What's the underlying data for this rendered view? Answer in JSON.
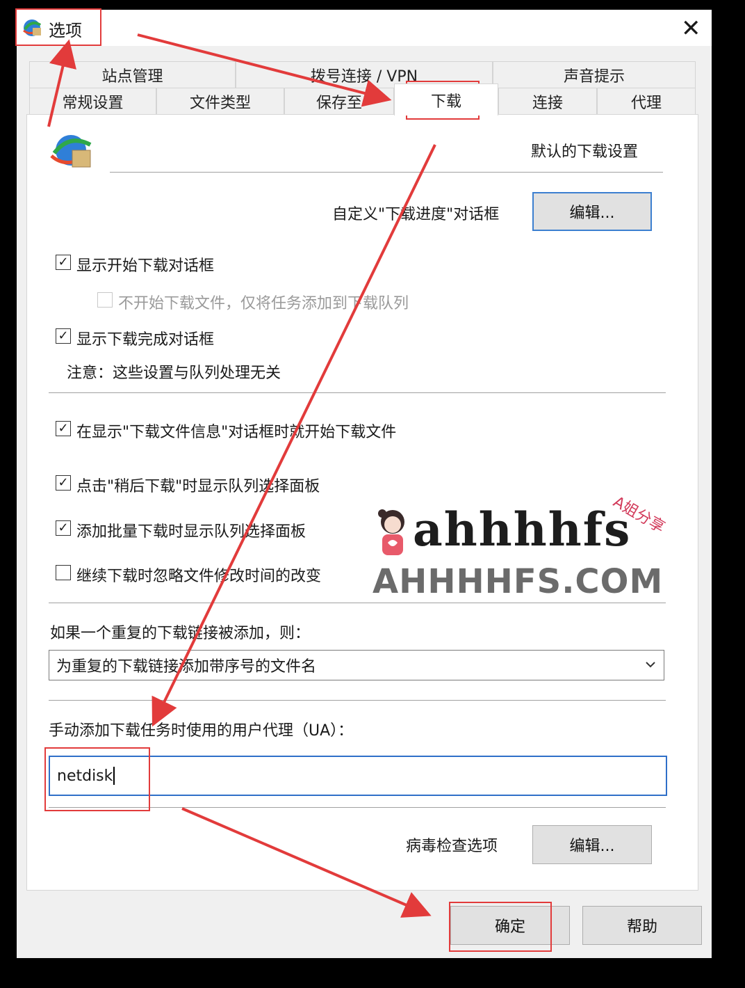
{
  "window": {
    "title": "选项",
    "close_glyph": "✕"
  },
  "tabs_row1": [
    "站点管理",
    "拨号连接 / VPN",
    "声音提示"
  ],
  "tabs_row2": [
    "常规设置",
    "文件类型",
    "保存至",
    "下载",
    "连接",
    "代理"
  ],
  "active_tab": "下载",
  "section_title": "默认的下载设置",
  "progress_dialog": {
    "label": "自定义\"下载进度\"对话框",
    "button": "编辑..."
  },
  "options": {
    "show_start_dialog": {
      "label": "显示开始下载对话框",
      "checked": true
    },
    "queue_without_start": {
      "label": "不开始下载文件，仅将任务添加到下载队列",
      "checked": false,
      "disabled": true
    },
    "show_complete_dialog": {
      "label": "显示下载完成对话框",
      "checked": true
    },
    "note": "注意：这些设置与队列处理无关",
    "start_on_info_dialog": {
      "label": "在显示\"下载文件信息\"对话框时就开始下载文件",
      "checked": true
    },
    "queue_panel_later": {
      "label": "点击\"稍后下载\"时显示队列选择面板",
      "checked": true
    },
    "queue_panel_batch": {
      "label": "添加批量下载时显示队列选择面板",
      "checked": true
    },
    "ignore_modified_time": {
      "label": "继续下载时忽略文件修改时间的改变",
      "checked": false
    }
  },
  "duplicate": {
    "label": "如果一个重复的下载链接被添加，则：",
    "selected": "为重复的下载链接添加带序号的文件名"
  },
  "user_agent": {
    "label": "手动添加下载任务时使用的用户代理（UA）：",
    "value": "netdisk"
  },
  "virus_check": {
    "label": "病毒检查选项",
    "button": "编辑..."
  },
  "footer": {
    "ok": "确定",
    "help": "帮助"
  },
  "watermark": {
    "logo_text": "ahhhhfs",
    "domain_text": "AHHHHFS.COM",
    "tag": "A姐分享"
  },
  "annotation_color": "#e23b3b"
}
